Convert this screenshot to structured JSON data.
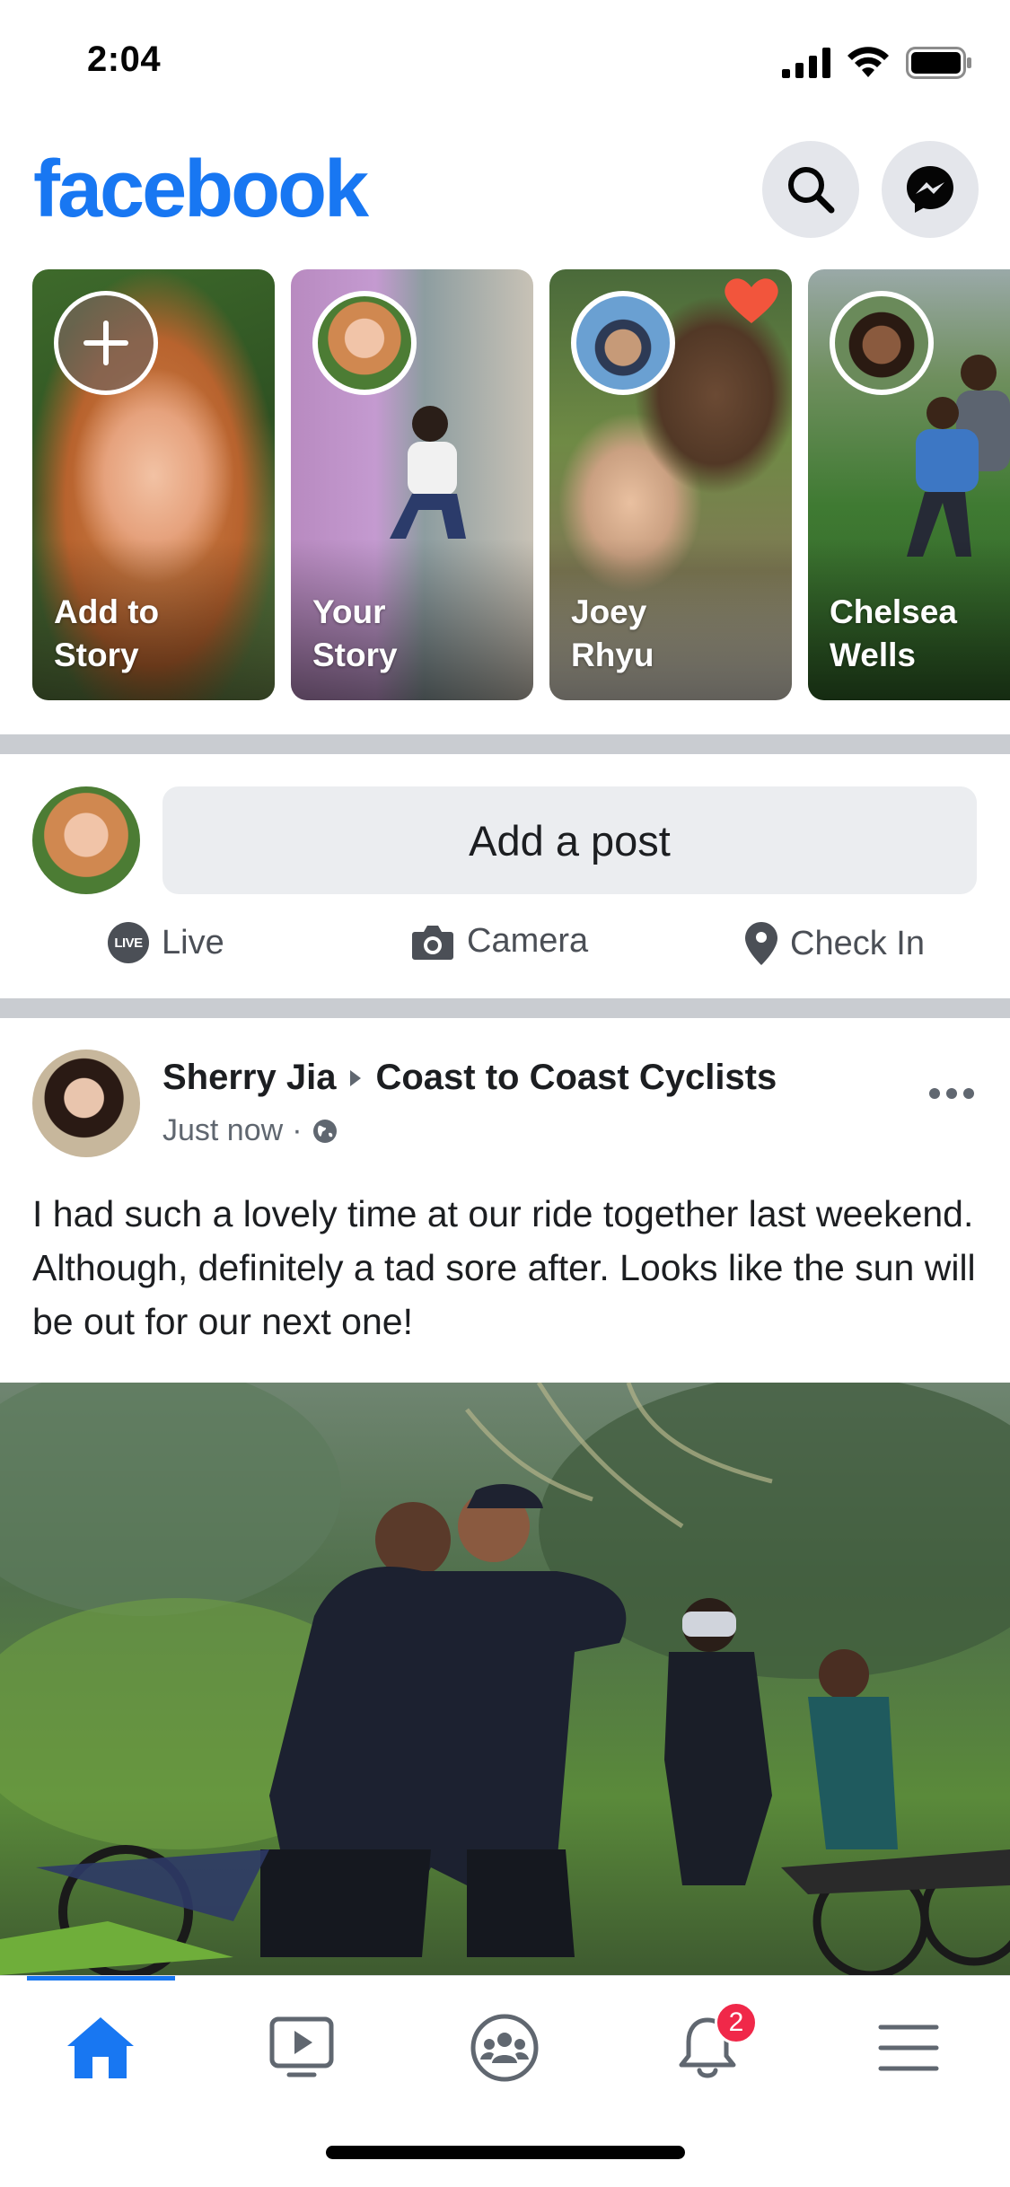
{
  "status_bar": {
    "time": "2:04"
  },
  "header": {
    "brand": "facebook",
    "search_icon": "search-icon",
    "messenger_icon": "messenger-icon"
  },
  "stories": [
    {
      "label": "Add to\nStory",
      "type": "add"
    },
    {
      "label": "Your\nStory",
      "type": "story"
    },
    {
      "label": "Joey\nRhyu",
      "type": "story"
    },
    {
      "label": "Chelsea\nWells",
      "type": "story"
    }
  ],
  "composer": {
    "add_post_label": "Add a post",
    "actions": [
      {
        "label": "Live",
        "badge": "LIVE"
      },
      {
        "label": "Camera"
      },
      {
        "label": "Check In"
      }
    ]
  },
  "post": {
    "author": "Sherry Jia",
    "group": "Coast to Coast Cyclists",
    "time": "Just now",
    "separator": "·",
    "text": "I had such a lovely time at our ride together last weekend. Although, definitely a tad sore after. Looks like the sun will be out for our next one!"
  },
  "tab_bar": {
    "active": "home",
    "notifications_count": "2",
    "accent": "#1877f2"
  }
}
